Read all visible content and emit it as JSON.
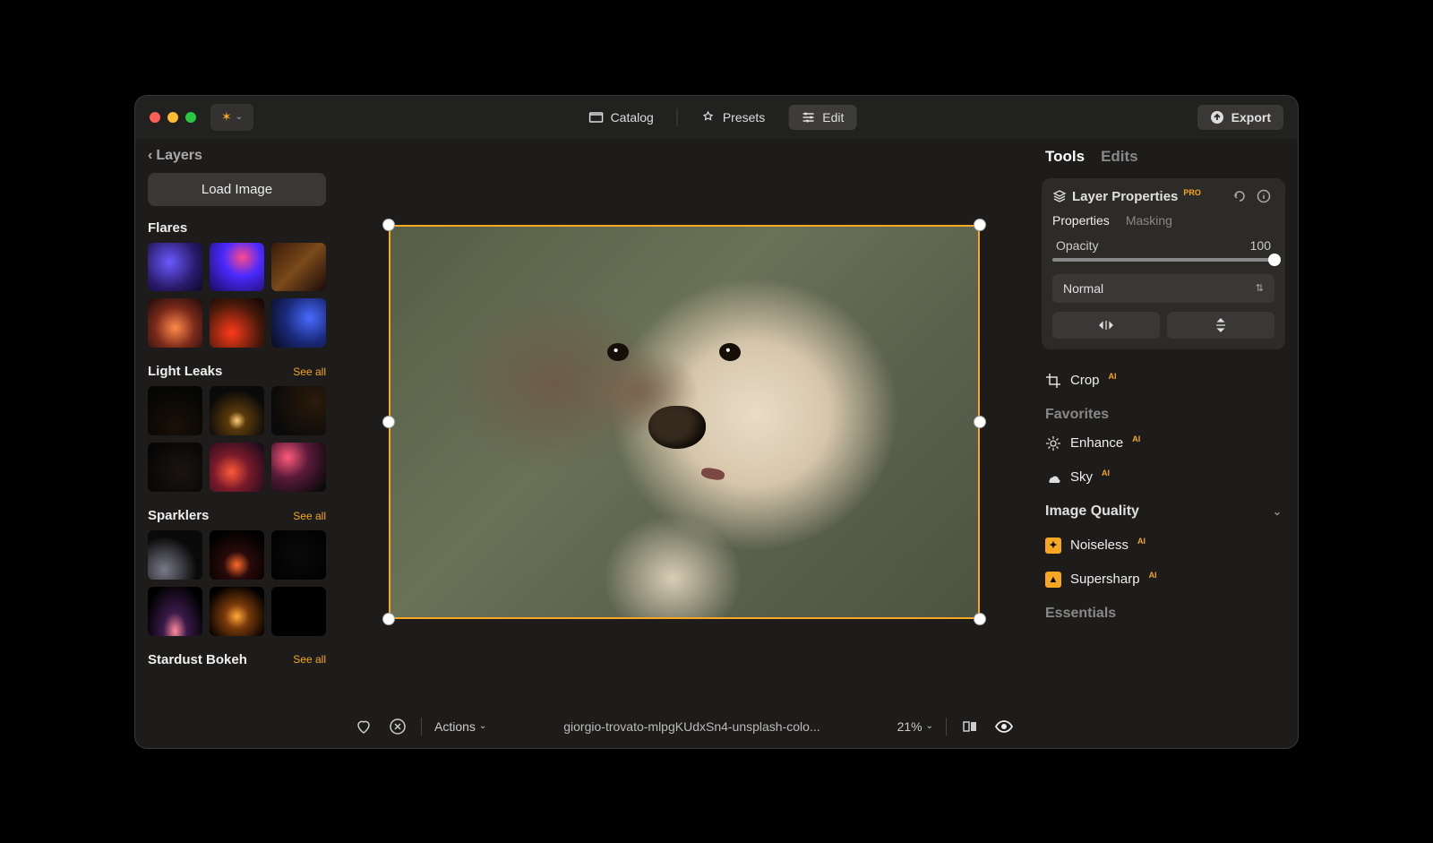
{
  "header": {
    "catalog": "Catalog",
    "presets": "Presets",
    "edit": "Edit",
    "export": "Export"
  },
  "sidebar": {
    "layers_label": "Layers",
    "load_image": "Load Image",
    "sections": [
      {
        "title": "Flares",
        "see_all": null
      },
      {
        "title": "Light Leaks",
        "see_all": "See all"
      },
      {
        "title": "Sparklers",
        "see_all": "See all"
      },
      {
        "title": "Stardust Bokeh",
        "see_all": "See all"
      }
    ],
    "flares_thumbs": [
      "radial-gradient(circle at 40% 40%, #6a5aff 0%, #2a1a6a 60%, #0a0a2a 100%)",
      "radial-gradient(circle at 60% 30%, #ff4a8a 0%, #4a2aff 40%, #1a0a5a 100%)",
      "linear-gradient(135deg, #3a1a0a 0%, #7a4a1a 50%, #1a0a0a 100%)",
      "radial-gradient(circle at 50% 60%, #ff8a4a 0%, #7a2a1a 50%, #1a0a0a 100%)",
      "radial-gradient(circle at 40% 70%, #ff3a1a 0%, #4a1a0a 60%, #0a0505 100%)",
      "radial-gradient(circle at 70% 40%, #4a6aff 0%, #1a2a7a 50%, #0a0a1a 100%)"
    ],
    "lightleaks_thumbs": [
      "radial-gradient(circle at 50% 80%, #1a1008 0%, #050503 80%)",
      "radial-gradient(circle at 50% 70%, #ffcf7a 0%, #5a3a0a 20%, #0a0a0a 70%)",
      "radial-gradient(circle at 80% 30%, #2a1a0a 0%, #0a0a0a 80%)",
      "radial-gradient(circle at 60% 60%, #1a1410 0%, #050505 90%)",
      "radial-gradient(circle at 40% 60%, #ff5a3a 0%, #7a1a2a 40%, #0a0a1a 100%)",
      "radial-gradient(circle at 30% 30%, #ff5a7a 0%, #5a1a3a 40%, #0a0a0a 90%)"
    ],
    "sparklers_thumbs": [
      "radial-gradient(circle at 30% 80%, #7a7a8a 0%, #0a0a0a 60%)",
      "radial-gradient(circle at 50% 70%, #ff6a2a 0%, #2a0a0a 30%, #000 80%)",
      "radial-gradient(circle at 50% 50%, #0a0a0a 0%, #000 100%)",
      "radial-gradient(ellipse at 50% 90%, #ff8a9a 0%, #3a1a4a 30%, #000 80%)",
      "radial-gradient(circle at 50% 60%, #ffaa3a 0%, #7a3a0a 30%, #000 80%)",
      "radial-gradient(circle at 50% 50%, #000 0%, #000 100%)"
    ]
  },
  "canvas": {
    "filename": "giorgio-trovato-mlpgKUdxSn4-unsplash-colo...",
    "zoom": "21%",
    "actions_label": "Actions"
  },
  "right": {
    "tabs": {
      "tools": "Tools",
      "edits": "Edits"
    },
    "layer_properties": {
      "title": "Layer Properties",
      "pro_badge": "PRO",
      "subtabs": {
        "properties": "Properties",
        "masking": "Masking"
      },
      "opacity_label": "Opacity",
      "opacity_value": "100",
      "blend_mode": "Normal"
    },
    "tools": {
      "crop": "Crop",
      "favorites": "Favorites",
      "enhance": "Enhance",
      "sky": "Sky",
      "image_quality": "Image Quality",
      "noiseless": "Noiseless",
      "supersharp": "Supersharp",
      "essentials": "Essentials",
      "ai_badge": "AI"
    }
  }
}
